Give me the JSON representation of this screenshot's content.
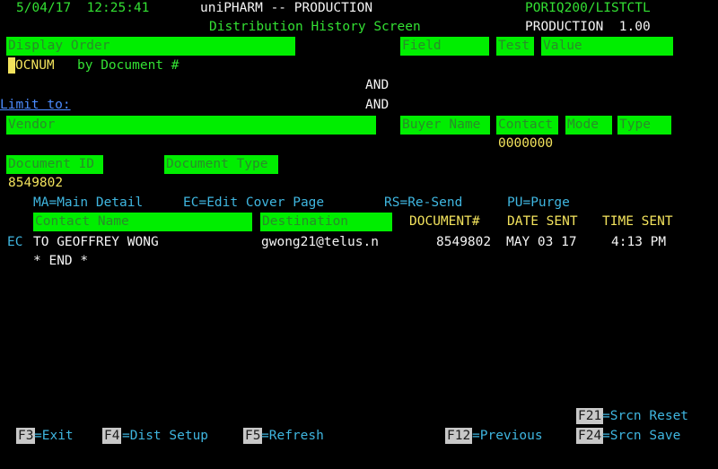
{
  "header": {
    "datetime": "5/04/17  12:25:41",
    "app": "uniPHARM -- PRODUCTION",
    "program": "PORIQ200/LISTCTL",
    "screen_title": "Distribution History Screen",
    "environment": "PRODUCTION  1.00"
  },
  "display_order": {
    "label": "Display Order",
    "field_label": "Field",
    "test_label": "Test",
    "value_label": "Value",
    "value": "OCNUM",
    "description": "by Document #",
    "and_1": "AND",
    "and_2": "AND"
  },
  "limit": {
    "label": "Limit to:",
    "vendor_label": "Vendor",
    "buyer_label": "Buyer Name",
    "contact_label": "Contact",
    "mode_label": "Mode",
    "type_label": "Type",
    "contact_value": "0000000",
    "doc_id_label": "Document ID",
    "doc_type_label": "Document Type",
    "doc_id_value": "8549802"
  },
  "options": {
    "ma": "MA=Main Detail",
    "ec": "EC=Edit Cover Page",
    "rs": "RS=Re-Send",
    "pu": "PU=Purge"
  },
  "table": {
    "columns": {
      "contact": "Contact Name",
      "destination": "Destination",
      "document": "DOCUMENT#",
      "date": "DATE SENT",
      "time": "TIME SENT"
    },
    "rows": [
      {
        "option": "EC",
        "contact": "TO GEOFFREY WONG",
        "destination": "gwong21@telus.n",
        "document": "8549802",
        "date": "MAY 03 17",
        "time": "4:13 PM"
      }
    ],
    "end_marker": "* END *"
  },
  "function_keys": {
    "f3": {
      "key": "F3",
      "label": "=Exit"
    },
    "f4": {
      "key": "F4",
      "label": "=Dist Setup"
    },
    "f5": {
      "key": "F5",
      "label": "=Refresh"
    },
    "f12": {
      "key": "F12",
      "label": "=Previous"
    },
    "f21": {
      "key": "F21",
      "label": "=Srcn Reset"
    },
    "f24": {
      "key": "F24",
      "label": "=Srcn Save"
    }
  }
}
